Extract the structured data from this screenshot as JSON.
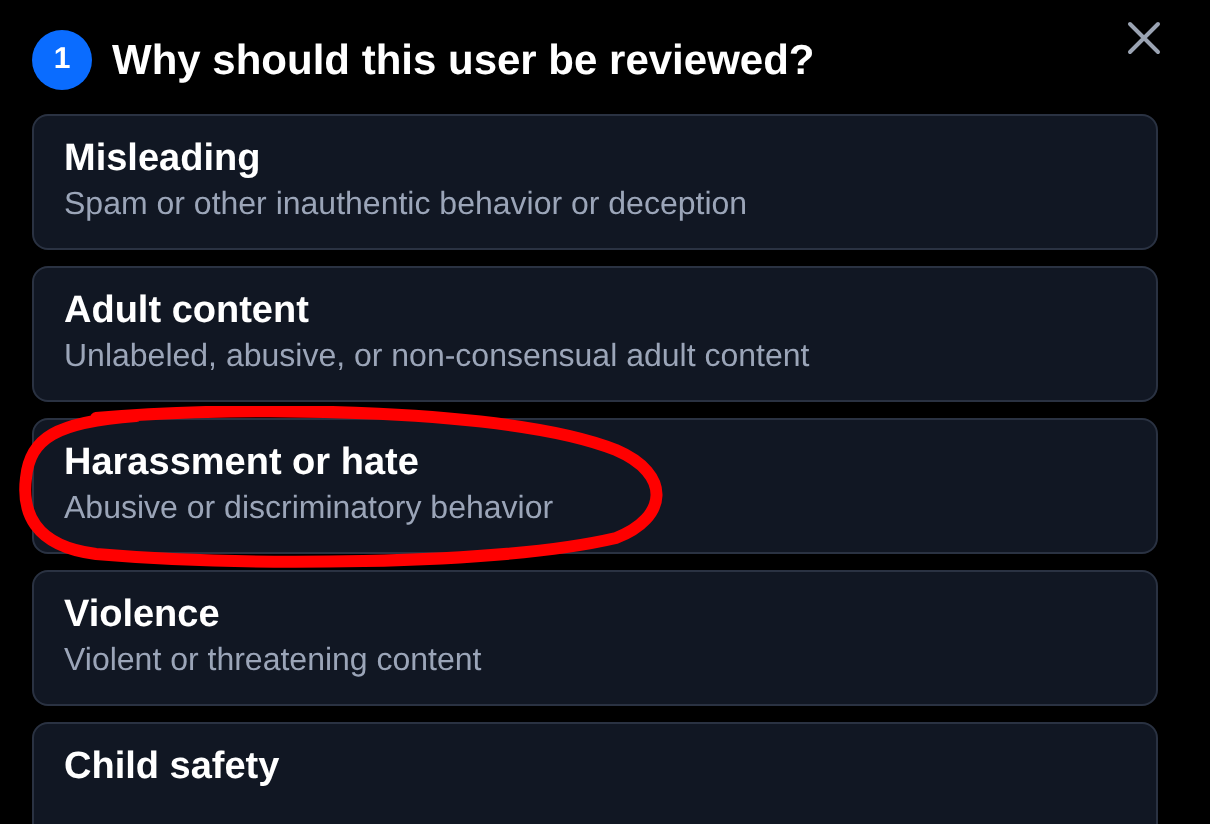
{
  "dialog": {
    "step": "1",
    "title": "Why should this user be reviewed?"
  },
  "options": [
    {
      "label": "Misleading",
      "description": "Spam or other inauthentic behavior or deception",
      "circled": false
    },
    {
      "label": "Adult content",
      "description": "Unlabeled, abusive, or non-consensual adult content",
      "circled": false
    },
    {
      "label": "Harassment or hate",
      "description": "Abusive or discriminatory behavior",
      "circled": true
    },
    {
      "label": "Violence",
      "description": "Violent or threatening content",
      "circled": false
    },
    {
      "label": "Child safety",
      "circled": false
    }
  ]
}
